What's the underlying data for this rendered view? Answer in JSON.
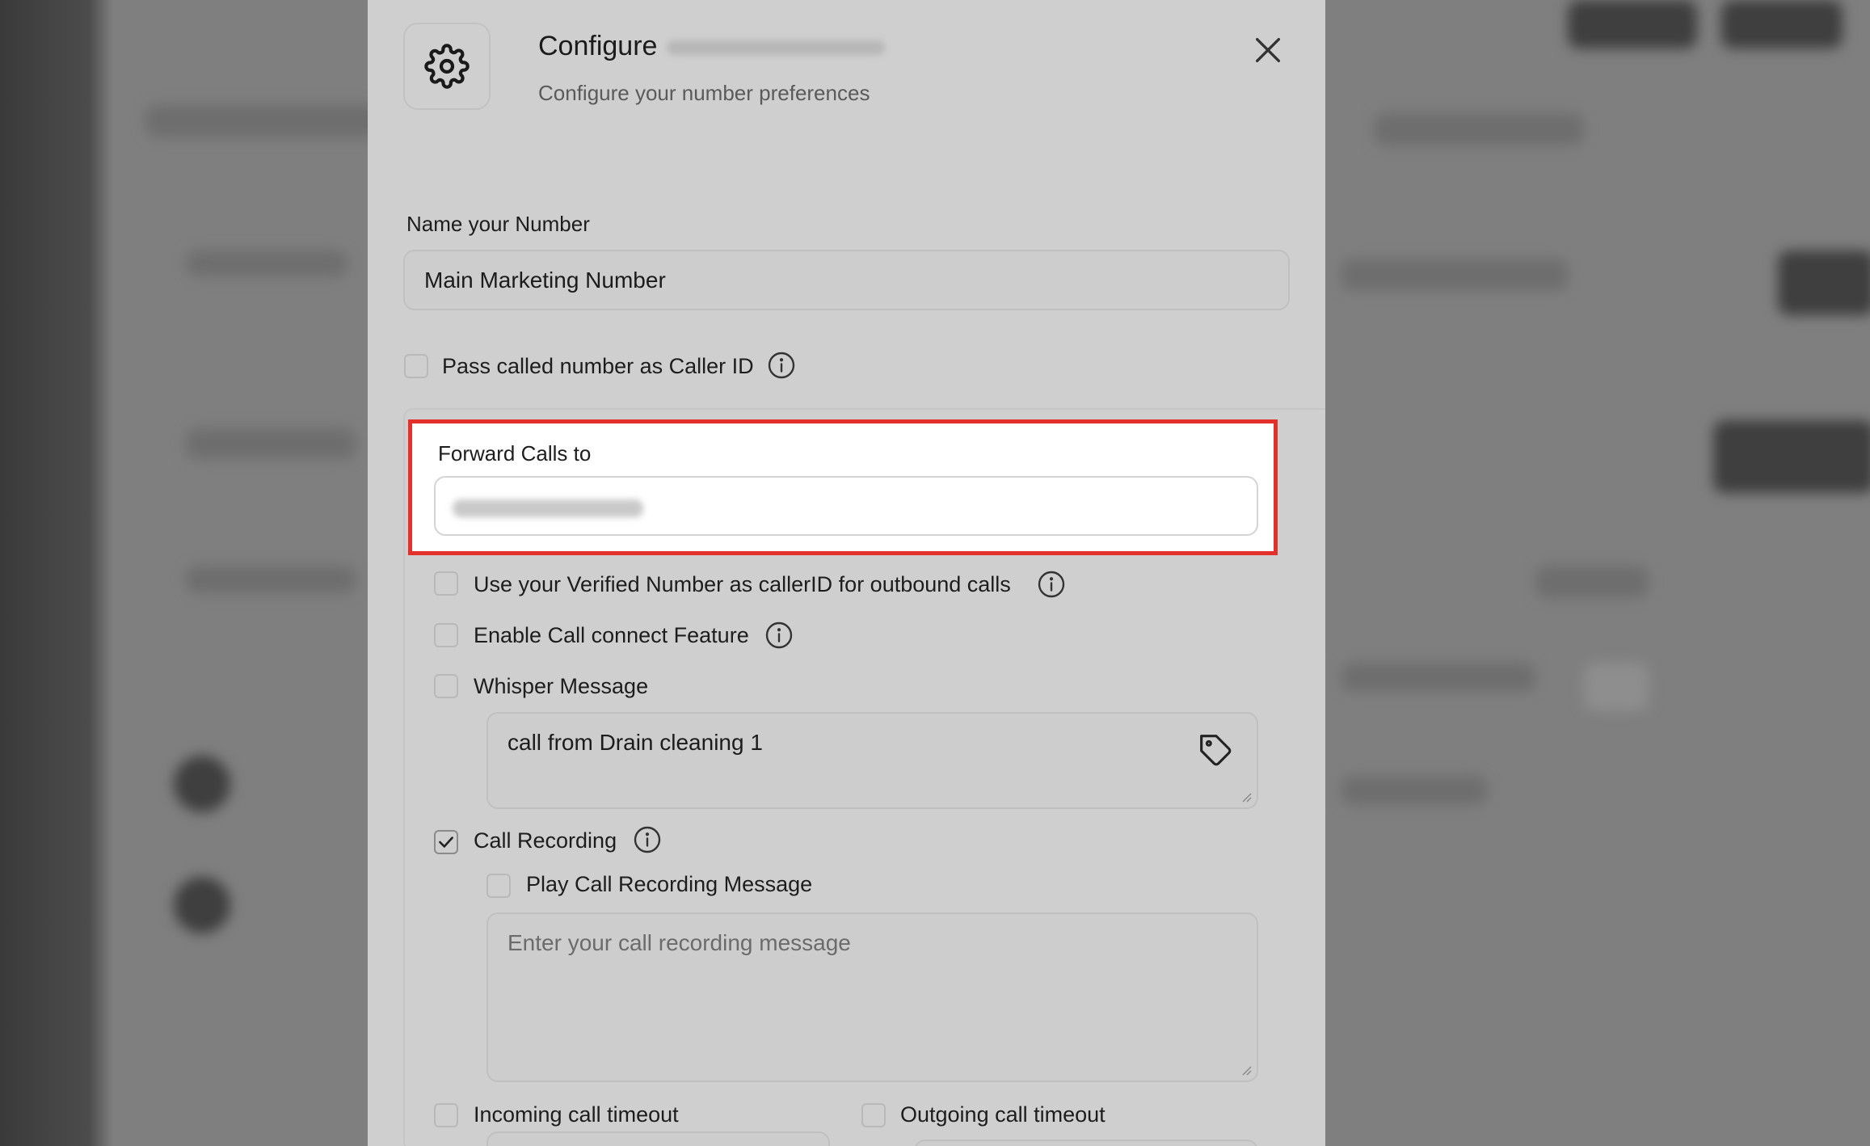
{
  "modal": {
    "title": "Configure",
    "subtitle": "Configure your number preferences"
  },
  "name_section": {
    "label": "Name your Number",
    "value": "Main Marketing Number"
  },
  "caller_id": {
    "label": "Pass called number as Caller ID",
    "checked": false
  },
  "forward": {
    "label": "Forward Calls to",
    "highlight_color": "#e4302b"
  },
  "options": {
    "verified_number": {
      "label": "Use your Verified Number as callerID for outbound calls",
      "checked": false
    },
    "call_connect": {
      "label": "Enable Call connect Feature",
      "checked": false
    },
    "whisper": {
      "label": "Whisper Message",
      "checked": false,
      "message": "call from Drain cleaning 1"
    },
    "call_recording": {
      "label": "Call Recording",
      "checked": true
    },
    "play_recording": {
      "label": "Play Call Recording Message",
      "checked": false,
      "placeholder": "Enter your call recording message"
    },
    "incoming_timeout": {
      "label": "Incoming call timeout",
      "checked": false
    },
    "outgoing_timeout": {
      "label": "Outgoing call timeout",
      "checked": false
    }
  },
  "icons": {
    "settings": "gear-icon",
    "close": "close-icon",
    "info": "info-icon",
    "tag": "tag-icon",
    "check": "check-icon"
  }
}
